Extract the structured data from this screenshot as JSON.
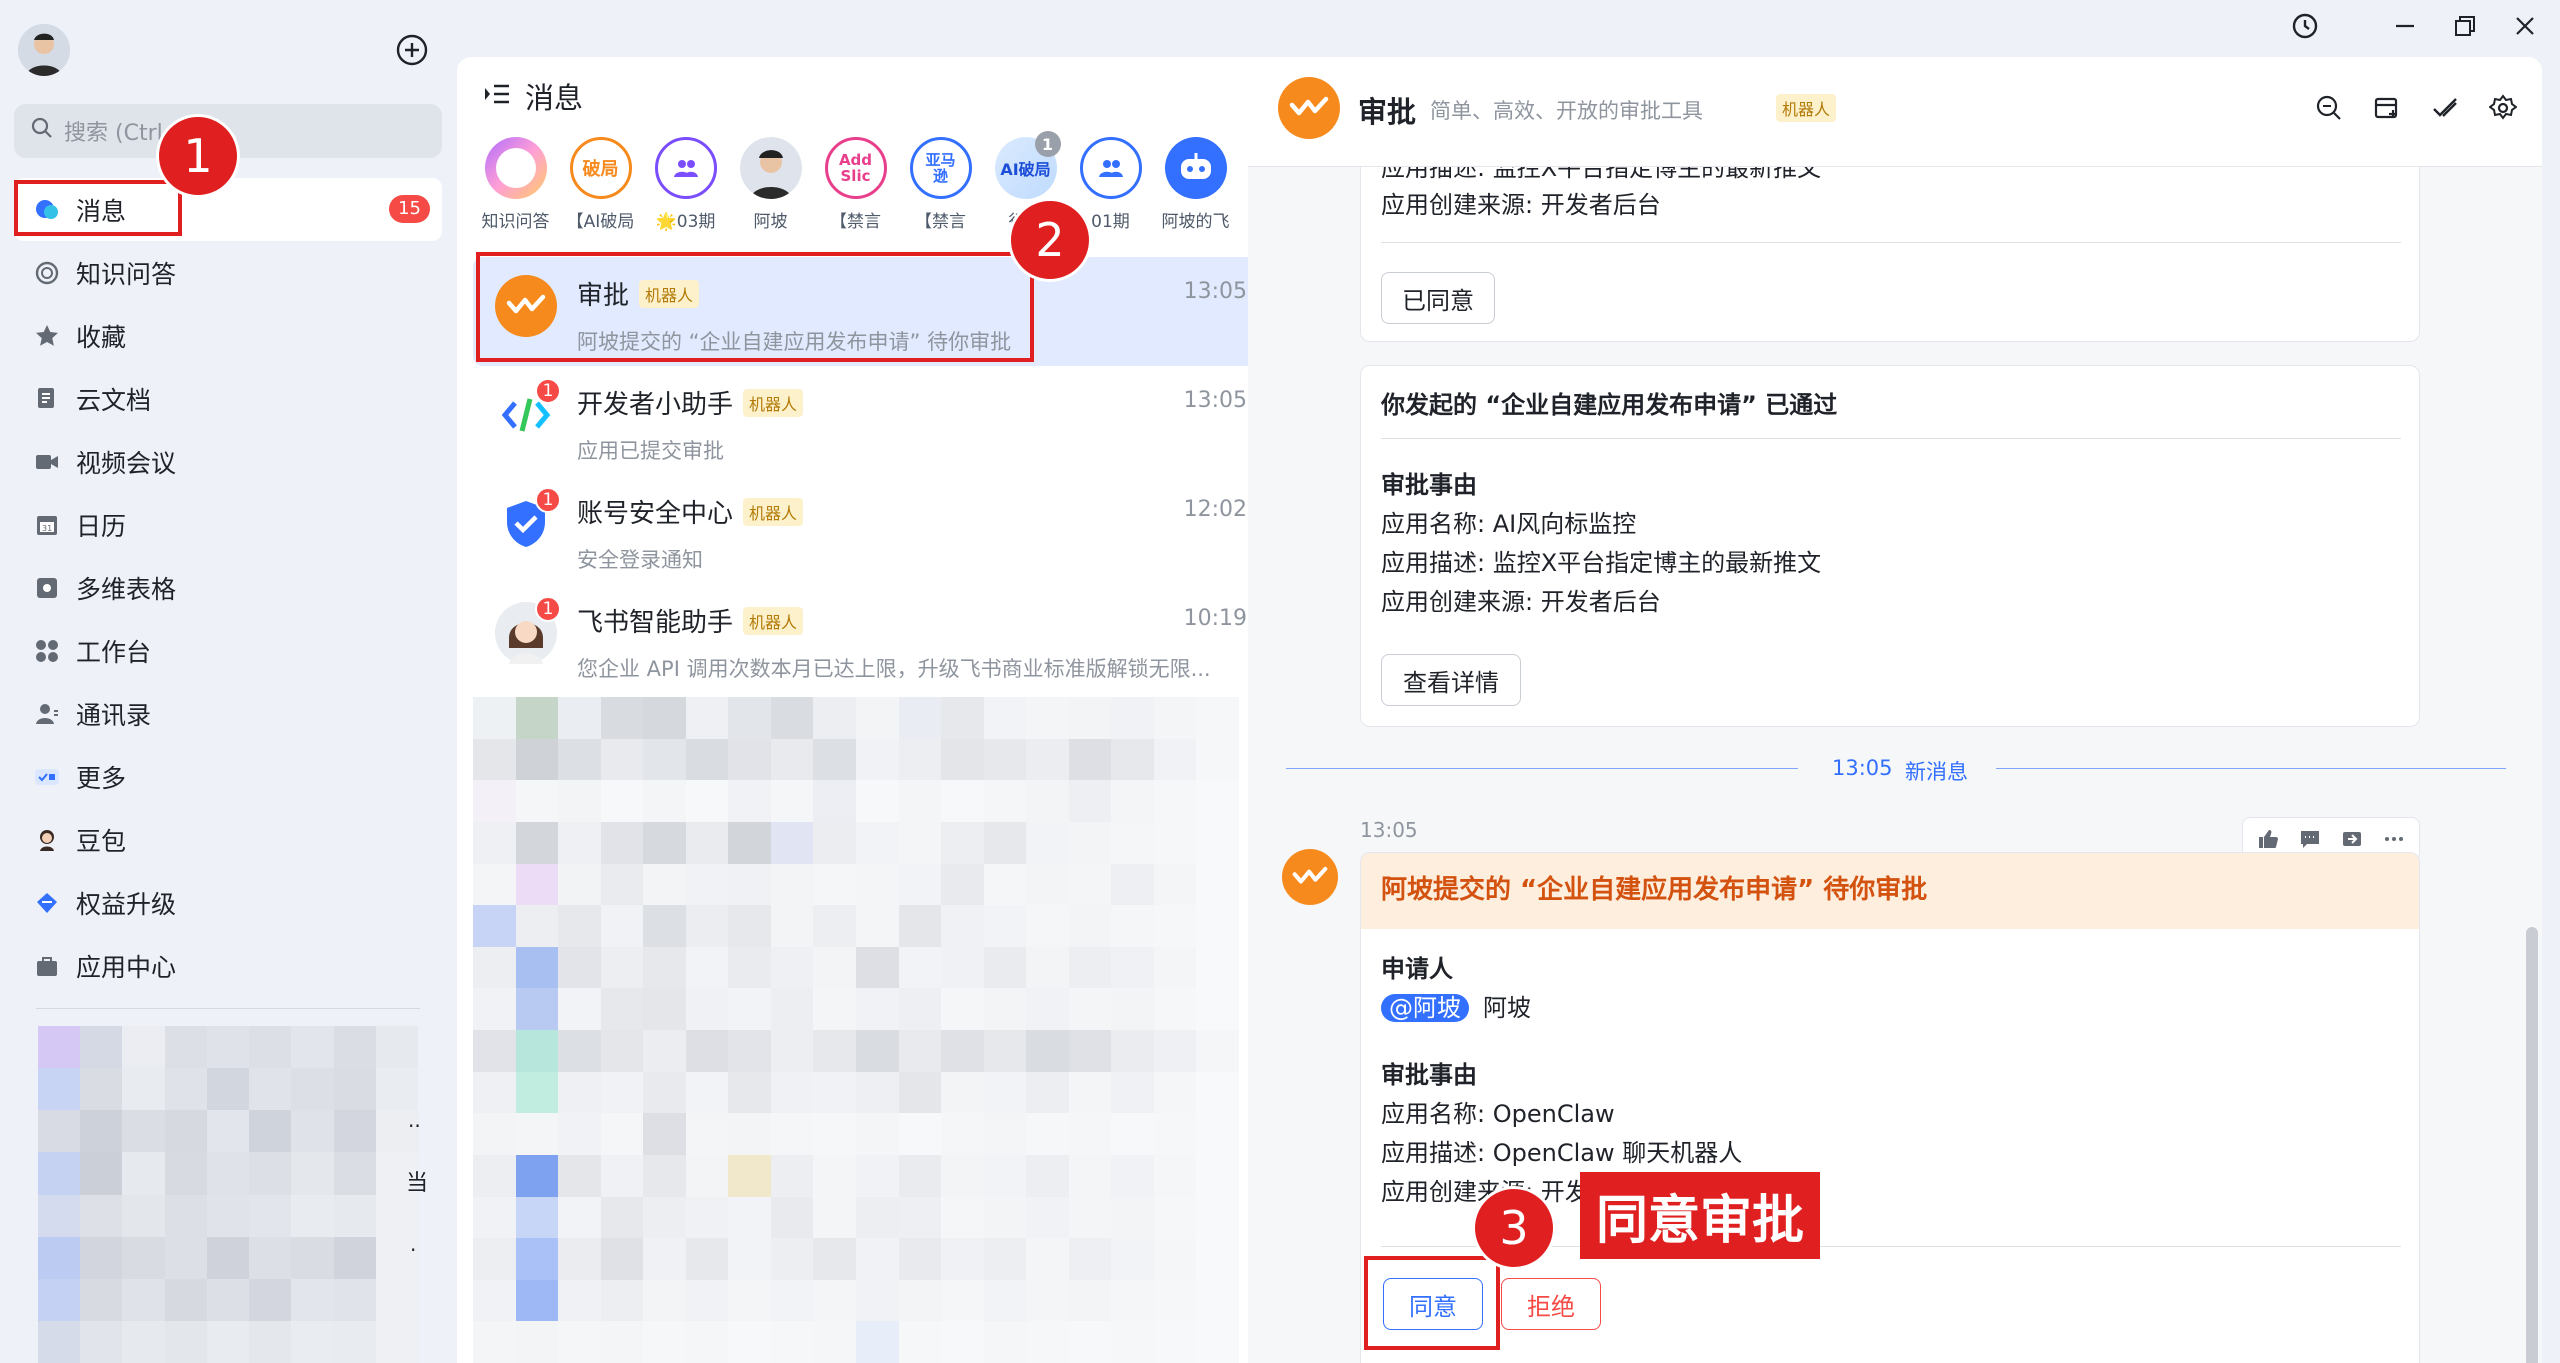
{
  "window": {
    "history_icon": "history-icon",
    "minimize_icon": "minimize-icon",
    "restore_icon": "restore-icon",
    "close_icon": "close-icon"
  },
  "sidebar": {
    "search_placeholder": "搜索 (Ctrl",
    "items": [
      {
        "label": "消息",
        "icon": "message-icon",
        "badge": "15"
      },
      {
        "label": "知识问答",
        "icon": "knowledge-icon"
      },
      {
        "label": "收藏",
        "icon": "star-icon"
      },
      {
        "label": "云文档",
        "icon": "doc-icon"
      },
      {
        "label": "视频会议",
        "icon": "video-icon"
      },
      {
        "label": "日历",
        "icon": "calendar-icon"
      },
      {
        "label": "多维表格",
        "icon": "table-icon"
      },
      {
        "label": "工作台",
        "icon": "workbench-icon"
      },
      {
        "label": "通讯录",
        "icon": "contacts-icon"
      },
      {
        "label": "更多",
        "icon": "more-icon"
      },
      {
        "label": "豆包",
        "icon": "doubao-icon"
      },
      {
        "label": "权益升级",
        "icon": "upgrade-icon"
      },
      {
        "label": "应用中心",
        "icon": "app-center-icon"
      }
    ],
    "blur_tail_1": "..",
    "blur_tail_2": "当",
    "blur_tail_3": "."
  },
  "middle": {
    "title": "消息",
    "pins": [
      {
        "label": "知识问答",
        "glyph": ""
      },
      {
        "label": "【AI破局",
        "glyph": "破局"
      },
      {
        "label": "🌟03期",
        "glyph": ""
      },
      {
        "label": "阿坡",
        "glyph": ""
      },
      {
        "label": "【禁言",
        "glyph": "Add Slic"
      },
      {
        "label": "【禁言",
        "glyph": "亚马逊"
      },
      {
        "label": "行动",
        "glyph": "AI破局",
        "count": "1"
      },
      {
        "label": "01期",
        "glyph": ""
      },
      {
        "label": "阿坡的飞",
        "glyph": ""
      }
    ],
    "chats": [
      {
        "name": "审批",
        "tag": "机器人",
        "time": "13:05",
        "preview": "阿坡提交的 “企业自建应用发布申请” 待你审批"
      },
      {
        "name": "开发者小助手",
        "tag": "机器人",
        "time": "13:05",
        "preview": "应用已提交审批",
        "unread": "1"
      },
      {
        "name": "账号安全中心",
        "tag": "机器人",
        "time": "12:02",
        "preview": "安全登录通知",
        "unread": "1"
      },
      {
        "name": "飞书智能助手",
        "tag": "机器人",
        "time": "10:19",
        "preview": "您企业 API 调用次数本月已达上限，升级飞书商业标准版解锁无限...",
        "unread": "1"
      }
    ]
  },
  "right": {
    "title": "审批",
    "subtitle": "简单、高效、开放的审批工具",
    "tag": "机器人",
    "card1": {
      "line_desc": "应用描述: 监控X平台指定博主的最新推文",
      "line_source": "应用创建来源: 开发者后台",
      "button": "已同意"
    },
    "card2": {
      "title": "你发起的 “企业自建应用发布申请” 已通过",
      "section": "审批事由",
      "line_name": "应用名称: AI风向标监控",
      "line_desc": "应用描述: 监控X平台指定博主的最新推文",
      "line_source": "应用创建来源: 开发者后台",
      "button": "查看详情"
    },
    "separator": {
      "time": "13:05",
      "label": "新消息"
    },
    "msg_time": "13:05",
    "card3": {
      "title": "阿坡提交的 “企业自建应用发布申请” 待你审批",
      "applicant_label": "申请人",
      "mention": "@阿坡",
      "applicant_name": "阿坡",
      "section": "审批事由",
      "line_name": "应用名称: OpenClaw",
      "line_desc": "应用描述: OpenClaw 聊天机器人",
      "line_source": "应用创建来源: 开发",
      "approve": "同意",
      "reject": "拒绝"
    }
  },
  "annotations": {
    "step1": "1",
    "step2": "2",
    "step3": "3",
    "step3_label": "同意审批"
  },
  "colors": {
    "accent": "#3370ff",
    "annotation_red": "#e02020",
    "approval_orange": "#f78a1d",
    "highlight_bg": "#fdeedd"
  }
}
